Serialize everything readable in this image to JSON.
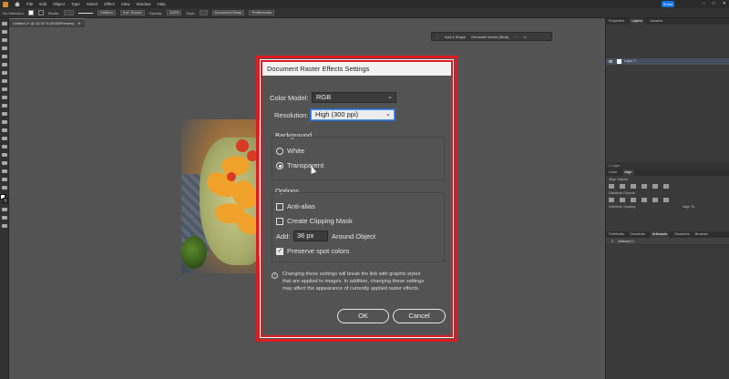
{
  "menubar": {
    "items": [
      "File",
      "Edit",
      "Object",
      "Type",
      "Select",
      "Effect",
      "View",
      "Window",
      "Help"
    ],
    "share_label": "Share"
  },
  "ctrlbar": {
    "selection": "No Selection",
    "stroke_label": "Stroke:",
    "brush": "Uniform",
    "brush_size": "5 pt. Round",
    "opacity_label": "Opacity:",
    "opacity_value": "100%",
    "style_label": "Style:",
    "doc_setup": "Document Setup",
    "preferences": "Preferences"
  },
  "doctab": {
    "title": "Untitled-1* @ 33.33 % (RGB/Preview)"
  },
  "taskbar": {
    "add_shape": "Add a Shape",
    "generate_vector": "Generate Vector (Beta)"
  },
  "layers_panel": {
    "tabs": [
      "Properties",
      "Layers",
      "Libraries"
    ],
    "active_tab": "Layers",
    "layer_name": "Layer 1",
    "footer": "1 Layer"
  },
  "align_panel": {
    "tabs": [
      "Color",
      "Align"
    ],
    "align_objects": "Align Objects:",
    "distribute_objects": "Distribute Objects:",
    "distribute_spacing": "Distribute Spacing:",
    "align_to": "Align To:"
  },
  "artboards_panel": {
    "tabs": [
      "Pathfinder",
      "Gradients",
      "Artboards",
      "Swatches",
      "Brushes"
    ],
    "active_tab": "Artboards",
    "row_index": "1",
    "row_name": "Artboard 1"
  },
  "dialog": {
    "title": "Document Raster Effects Settings",
    "color_model_label": "Color Model:",
    "color_model_value": "RGB",
    "resolution_label": "Resolution:",
    "resolution_value": "High (300 ppi)",
    "background_label": "Background",
    "bg_white": "White",
    "bg_transparent": "Transparent",
    "bg_selected": "Transparent",
    "options_label": "Options",
    "anti_alias": "Anti-alias",
    "anti_alias_checked": false,
    "clipping_mask": "Create Clipping Mask",
    "clipping_mask_checked": false,
    "add_label": "Add:",
    "add_value": "36 px",
    "around_object": "Around Object",
    "preserve_spot": "Preserve spot colors",
    "preserve_spot_checked": true,
    "info_line1": "Changing these settings will break the link with graphic styles",
    "info_line2": "that are applied to images. In addition, changing these settings",
    "info_line3": "may affect the appearance of currently applied raster effects.",
    "ok_label": "OK",
    "cancel_label": "Cancel"
  },
  "colors": {
    "highlight_red": "#e01a22",
    "canvas": "#535353",
    "panel": "#3a3a3a",
    "accent_blue": "#1473e6"
  }
}
